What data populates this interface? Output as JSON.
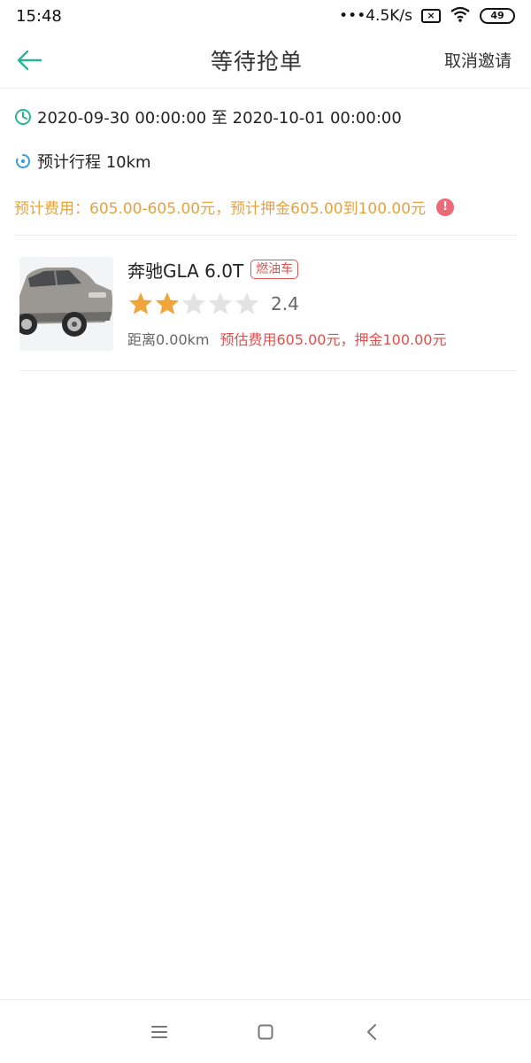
{
  "status_bar": {
    "time": "15:48",
    "network_speed": "•••4.5K/s",
    "sim_icon": "x-sim-icon",
    "battery": "49"
  },
  "nav": {
    "title": "等待抢单",
    "cancel_label": "取消邀请"
  },
  "trip": {
    "time_range": "2020-09-30 00:00:00 至 2020-10-01 00:00:00",
    "distance": "预计行程 10km",
    "fee_estimate": "预计费用：605.00-605.00元，预计押金605.00到100.00元",
    "warn_glyph": "!"
  },
  "car": {
    "name": "奔驰GLA 6.0T",
    "fuel_tag": "燃油车",
    "rating": 2.4,
    "rating_text": "2.4",
    "stars_filled": 2,
    "stars_total": 5,
    "distance": "距离0.00km",
    "fee": "预估费用605.00元，押金100.00元"
  },
  "colors": {
    "accent_teal": "#2bb39a",
    "fee_orange": "#e8a23c",
    "alert_red": "#d9534f",
    "star_gold": "#f0a43a",
    "star_empty": "#e3e3e3"
  }
}
